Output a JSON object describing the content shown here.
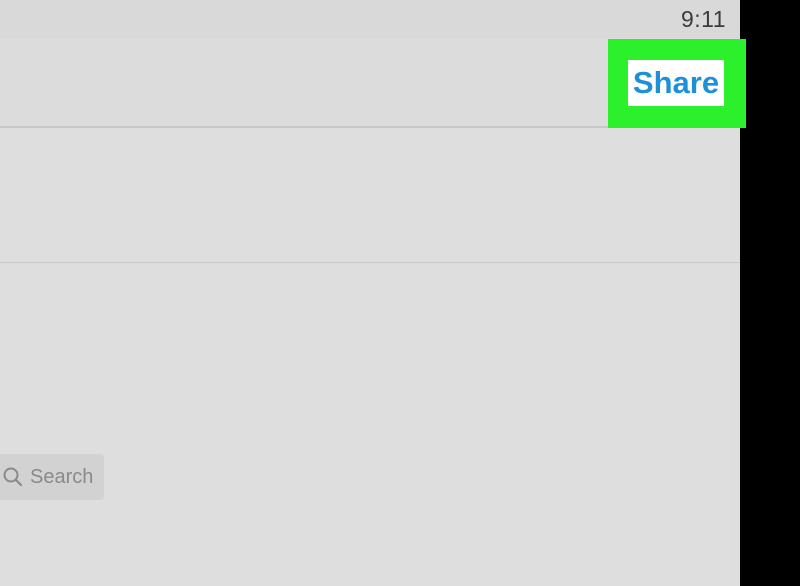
{
  "status_bar": {
    "time": "9:11"
  },
  "header": {
    "share_label": "Share"
  },
  "search": {
    "placeholder": "Search",
    "icon": "search-icon"
  },
  "colors": {
    "highlight": "#2df02d",
    "share_text": "#1e90d8",
    "background": "#dedede",
    "bezel": "#000000"
  }
}
